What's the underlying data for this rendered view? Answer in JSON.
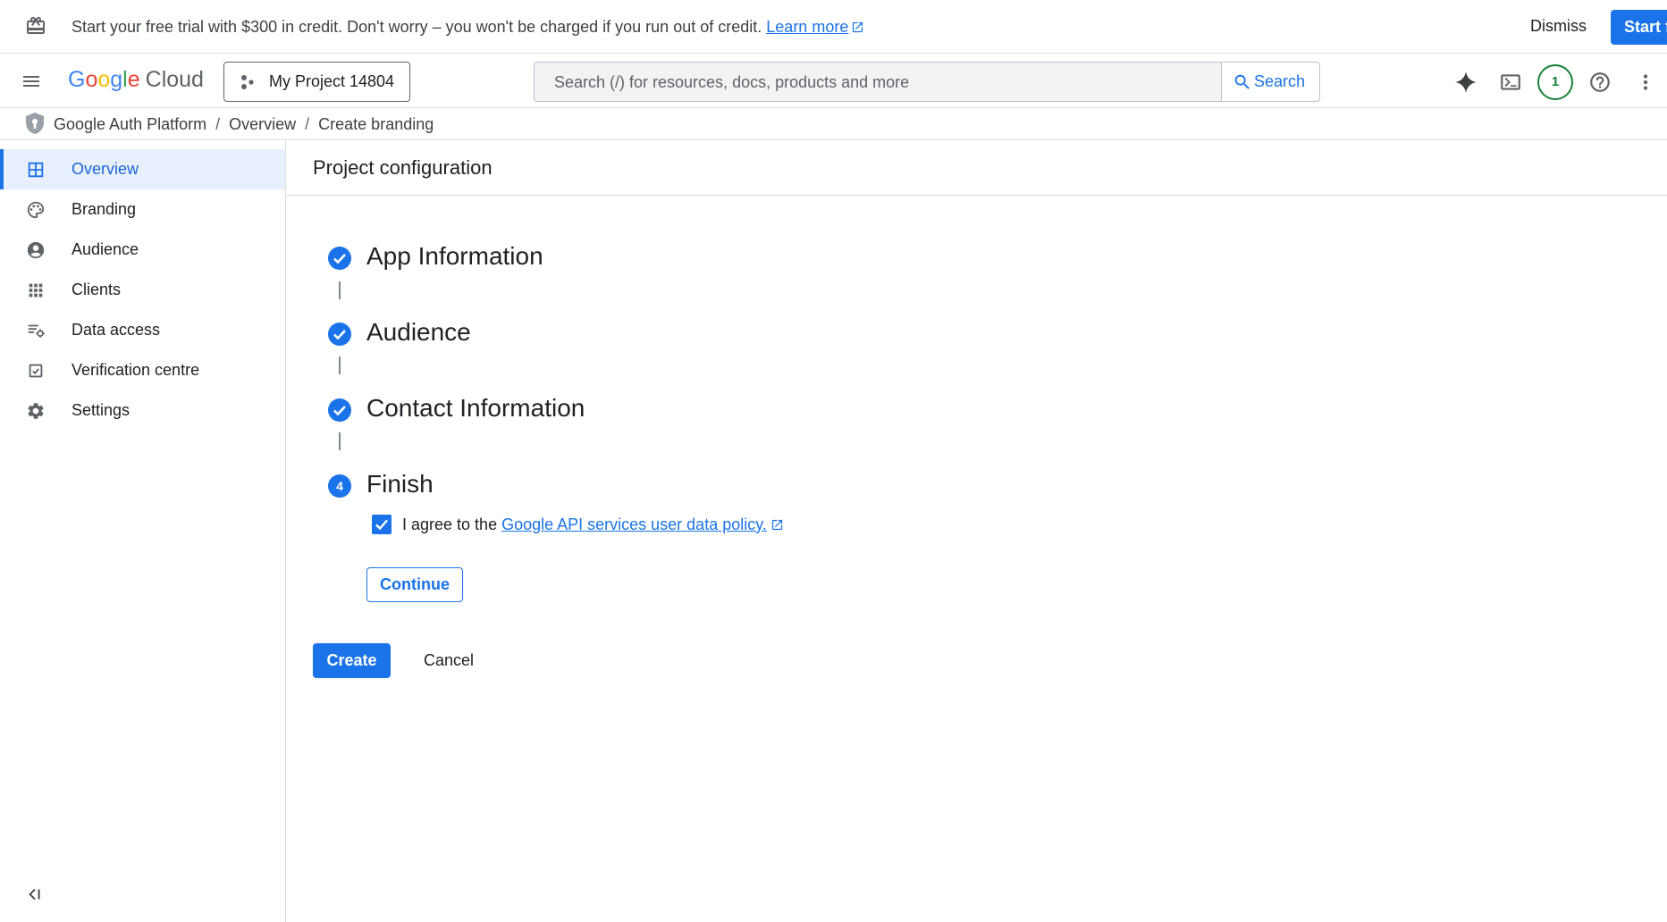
{
  "banner": {
    "message": "Start your free trial with $300 in credit. Don't worry – you won't be charged if you run out of credit.",
    "learn_more": "Learn more",
    "dismiss": "Dismiss",
    "start": "Start free"
  },
  "appbar": {
    "logo_google": [
      "G",
      "o",
      "o",
      "g",
      "l",
      "e"
    ],
    "logo_cloud": "Cloud",
    "project": "My Project 14804",
    "search_placeholder": "Search (/) for resources, docs, products and more",
    "search_button": "Search",
    "notification_count": "1"
  },
  "breadcrumb": {
    "items": [
      "Google Auth Platform",
      "Overview",
      "Create branding"
    ],
    "separator": "/"
  },
  "sidebar": {
    "items": [
      {
        "label": "Overview",
        "icon": "dashboard-icon",
        "active": true
      },
      {
        "label": "Branding",
        "icon": "palette-icon",
        "active": false
      },
      {
        "label": "Audience",
        "icon": "account-circle-icon",
        "active": false
      },
      {
        "label": "Clients",
        "icon": "apps-grid-icon",
        "active": false
      },
      {
        "label": "Data access",
        "icon": "data-settings-icon",
        "active": false
      },
      {
        "label": "Verification centre",
        "icon": "verified-box-icon",
        "active": false
      },
      {
        "label": "Settings",
        "icon": "gear-icon",
        "active": false
      }
    ]
  },
  "main": {
    "title": "Project configuration",
    "steps": [
      {
        "label": "App Information",
        "state": "complete"
      },
      {
        "label": "Audience",
        "state": "complete"
      },
      {
        "label": "Contact Information",
        "state": "complete"
      },
      {
        "label": "Finish",
        "state": "current",
        "number": "4"
      }
    ],
    "agree_text": "I agree to the",
    "agree_link": "Google API services user data policy.",
    "agree_checked": true,
    "continue": "Continue",
    "create": "Create",
    "cancel": "Cancel"
  },
  "colors": {
    "accent": "#1a73e8",
    "active_nav_bg": "#e8f0fe",
    "notification_ring": "#188038"
  }
}
